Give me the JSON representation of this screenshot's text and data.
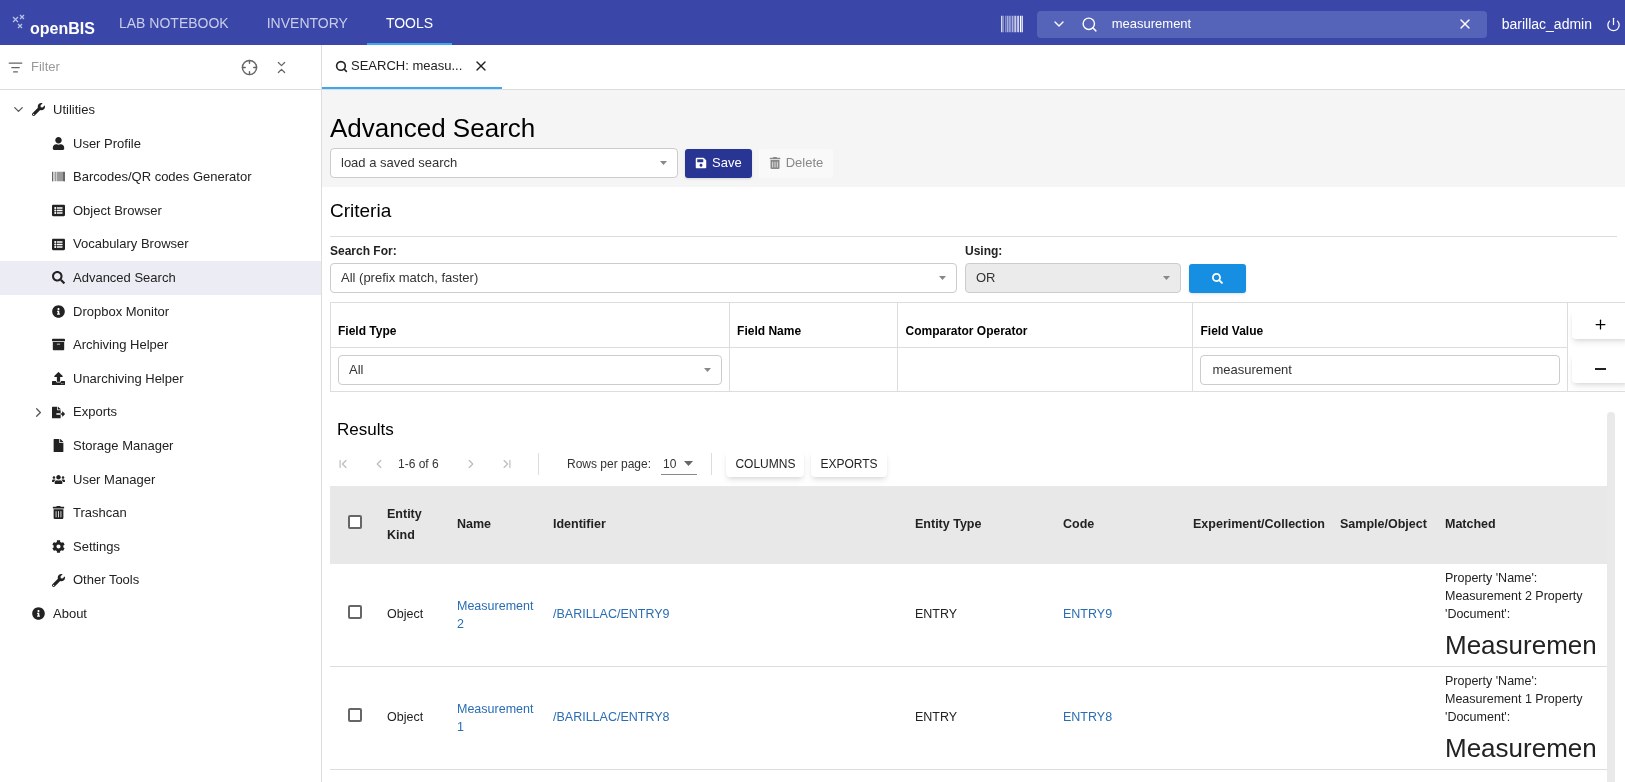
{
  "top_bar": {
    "logo": "openBIS",
    "tabs": [
      {
        "label": "LAB NOTEBOOK",
        "selected": false
      },
      {
        "label": "INVENTORY",
        "selected": false
      },
      {
        "label": "TOOLS",
        "selected": true
      }
    ],
    "search": {
      "value": "measurement"
    },
    "user": "barillac_admin"
  },
  "sidebar": {
    "filter": {
      "placeholder": "Filter"
    },
    "tree": [
      {
        "label": "Utilities",
        "expanded": true,
        "selected": false,
        "children": [
          {
            "label": "User Profile",
            "selected": false
          },
          {
            "label": "Barcodes/QR codes Generator",
            "selected": false
          },
          {
            "label": "Object Browser",
            "selected": false
          },
          {
            "label": "Vocabulary Browser",
            "selected": false
          },
          {
            "label": "Advanced Search",
            "selected": true
          },
          {
            "label": "Dropbox Monitor",
            "selected": false
          },
          {
            "label": "Archiving Helper",
            "selected": false
          },
          {
            "label": "Unarchiving Helper",
            "selected": false
          },
          {
            "label": "Exports",
            "selected": false,
            "expanded": false
          },
          {
            "label": "Storage Manager",
            "selected": false
          },
          {
            "label": "User Manager",
            "selected": false
          },
          {
            "label": "Trashcan",
            "selected": false
          },
          {
            "label": "Settings",
            "selected": false
          },
          {
            "label": "Other Tools",
            "selected": false
          }
        ]
      },
      {
        "label": "About",
        "selected": false
      }
    ]
  },
  "open_tab": {
    "label": "SEARCH: measu...",
    "selected": true
  },
  "page": {
    "title": "Advanced Search",
    "saved_search": {
      "value": "load a saved search"
    },
    "buttons": [
      {
        "label": "Save",
        "disabled": false
      },
      {
        "label": "Delete",
        "disabled": true
      }
    ]
  },
  "criteria": {
    "heading": "Criteria",
    "search_for": {
      "label": "Search For:",
      "value": "All (prefix match, faster)"
    },
    "using": {
      "label": "Using:",
      "value": "OR",
      "disabled": true
    },
    "columns": [
      "Field Type",
      "Field Name",
      "Comparator Operator",
      "Field Value"
    ],
    "rows": [
      {
        "field_type": "All",
        "field_value": "measurement"
      }
    ]
  },
  "results": {
    "heading": "Results",
    "pagination": {
      "range": "1-6 of 6",
      "rows_per_page_label": "Rows per page:",
      "rows_per_page": "10"
    },
    "buttons": [
      "COLUMNS",
      "EXPORTS"
    ],
    "all_selected": false,
    "columns": [
      "Entity Kind",
      "Name",
      "Identifier",
      "Entity Type",
      "Code",
      "Experiment/Collection",
      "Sample/Object",
      "Matched"
    ],
    "rows": [
      {
        "selected": false,
        "entity_kind": "Object",
        "name": "Measurement 2",
        "identifier": "/BARILLAC/ENTRY9",
        "entity_type": "ENTRY",
        "code": "ENTRY9",
        "matched": "Property 'Name': Measurement 2 Property 'Document':",
        "matched_preview": "Measuremen"
      },
      {
        "selected": false,
        "entity_kind": "Object",
        "name": "Measurement 1",
        "identifier": "/BARILLAC/ENTRY8",
        "entity_type": "ENTRY",
        "code": "ENTRY8",
        "matched": "Property 'Name': Measurement 1 Property 'Document':",
        "matched_preview": "Measuremen"
      }
    ]
  }
}
